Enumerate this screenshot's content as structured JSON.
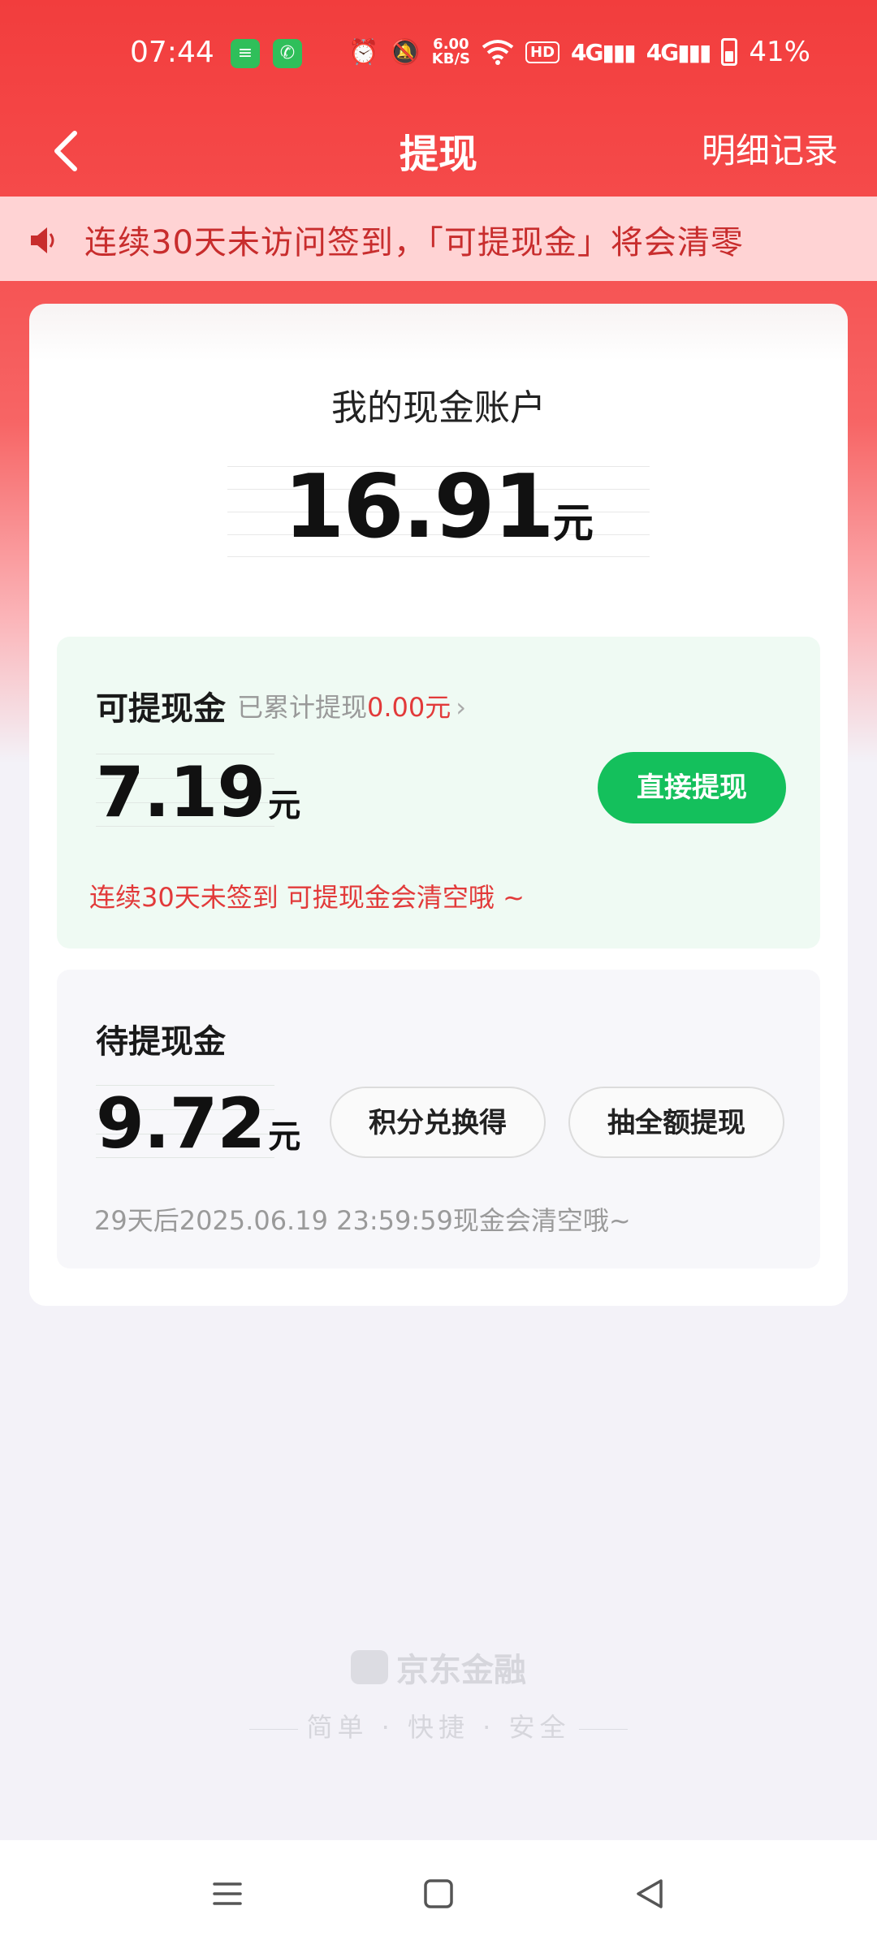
{
  "status_bar": {
    "time": "07:44",
    "net_speed_value": "6.00",
    "net_speed_unit": "KB/S",
    "network_1": "4G",
    "network_2": "4G",
    "hd_label": "HD",
    "battery": "41%"
  },
  "header": {
    "title": "提现",
    "detail_link": "明细记录"
  },
  "notice": {
    "text": "连续30天未访问签到，「可提现金」将会清零"
  },
  "account": {
    "label": "我的现金账户",
    "amount": "16.91",
    "unit": "元"
  },
  "withdrawable": {
    "title": "可提现金",
    "accumulated_prefix": "已累计提现",
    "accumulated_value": "0.00元",
    "amount": "7.19",
    "unit": "元",
    "button": "直接提现",
    "warning": "连续30天未签到 可提现金会清空哦 ~"
  },
  "pending": {
    "title": "待提现金",
    "amount": "9.72",
    "unit": "元",
    "button_exchange": "积分兑换得",
    "button_draw": "抽全额提现",
    "expire_note": "29天后2025.06.19 23:59:59现金会清空哦~"
  },
  "brand": {
    "name": "京东金融",
    "slogan_1": "简单",
    "slogan_2": "快捷",
    "slogan_3": "安全"
  },
  "colors": {
    "header_red": "#f23d3d",
    "notice_bg": "#ffd3d4",
    "accent_red": "#e23a3a",
    "action_green": "#14c05c",
    "green_section_bg": "#effaf3"
  },
  "icons": {
    "back": "chevron-left-icon",
    "notice": "speaker-icon",
    "nav_menu": "menu-icon",
    "nav_home": "home-square-icon",
    "nav_back": "triangle-back-icon"
  }
}
